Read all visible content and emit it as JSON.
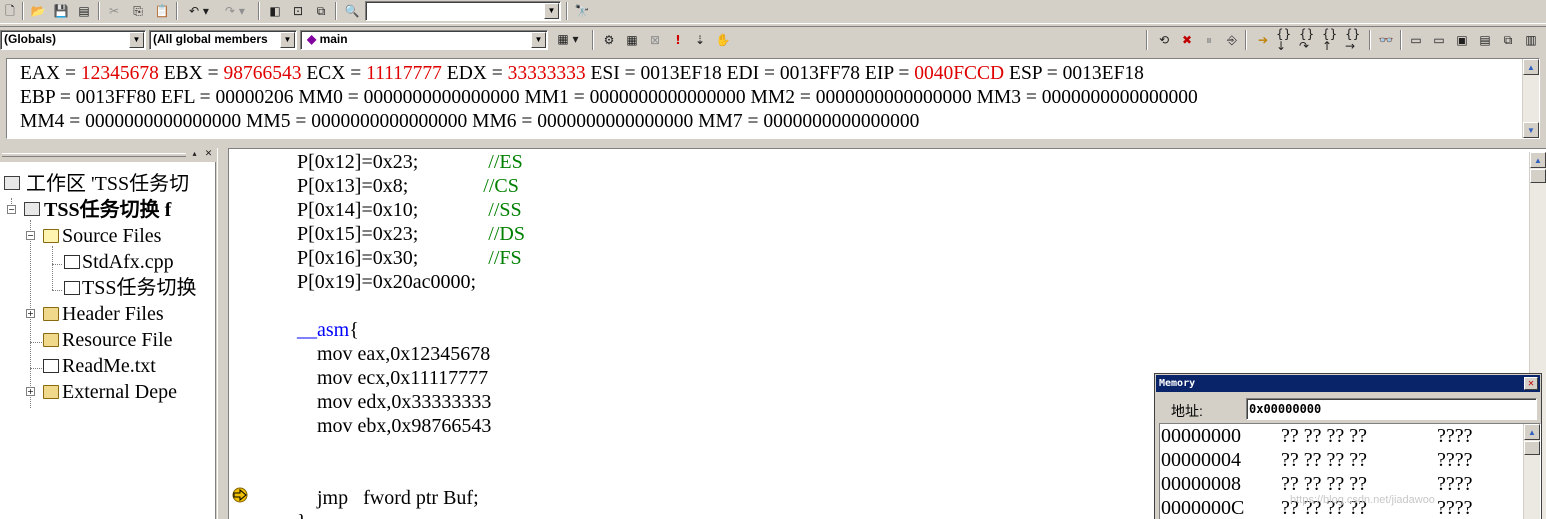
{
  "toolbar2": {
    "scope": "(Globals)",
    "members": "(All global members",
    "function": "main"
  },
  "registers": {
    "lines": [
      [
        {
          "text": "EAX = ",
          "changed": false
        },
        {
          "text": "12345678",
          "changed": true
        },
        {
          "text": " EBX = ",
          "changed": false
        },
        {
          "text": "98766543",
          "changed": true
        },
        {
          "text": " ECX = ",
          "changed": false
        },
        {
          "text": "11117777",
          "changed": true
        },
        {
          "text": " EDX = ",
          "changed": false
        },
        {
          "text": "33333333",
          "changed": true
        },
        {
          "text": " ESI = 0013EF18 EDI = 0013FF78 EIP = ",
          "changed": false
        },
        {
          "text": "0040FCCD",
          "changed": true
        },
        {
          "text": " ESP = 0013EF18",
          "changed": false
        }
      ],
      [
        {
          "text": "EBP = 0013FF80 EFL = 00000206 MM0 = 0000000000000000 MM1 = 0000000000000000 MM2 = 0000000000000000 MM3 = 0000000000000000",
          "changed": false
        }
      ],
      [
        {
          "text": "MM4 = 0000000000000000 MM5 = 0000000000000000 MM6 = 0000000000000000 MM7 = 0000000000000000",
          "changed": false
        }
      ]
    ],
    "changed_color": "#e00000"
  },
  "workspace": {
    "items": [
      {
        "label": "工作区 'TSS任务切",
        "icon": "workspace-icon",
        "bold": false
      },
      {
        "label": "TSS任务切换 f",
        "icon": "project-icon",
        "bold": true
      },
      {
        "label": "Source Files",
        "icon": "folder-open-icon",
        "bold": false
      },
      {
        "label": "StdAfx.cpp",
        "icon": "cpp-file-icon",
        "bold": false
      },
      {
        "label": "TSS任务切换",
        "icon": "cpp-file-icon",
        "bold": false
      },
      {
        "label": "Header Files",
        "icon": "folder-icon",
        "bold": false
      },
      {
        "label": "Resource File",
        "icon": "folder-icon",
        "bold": false
      },
      {
        "label": "ReadMe.txt",
        "icon": "text-file-icon",
        "bold": false
      },
      {
        "label": "External Depe",
        "icon": "folder-icon",
        "bold": false
      }
    ]
  },
  "code": {
    "lines": [
      [
        {
          "t": "P[0x12]=0x23;              ",
          "c": "plain"
        },
        {
          "t": "//ES",
          "c": "comment"
        }
      ],
      [
        {
          "t": "P[0x13]=0x8;               ",
          "c": "plain"
        },
        {
          "t": "//CS",
          "c": "comment"
        }
      ],
      [
        {
          "t": "P[0x14]=0x10;              ",
          "c": "plain"
        },
        {
          "t": "//SS",
          "c": "comment"
        }
      ],
      [
        {
          "t": "P[0x15]=0x23;              ",
          "c": "plain"
        },
        {
          "t": "//DS",
          "c": "comment"
        }
      ],
      [
        {
          "t": "P[0x16]=0x30;              ",
          "c": "plain"
        },
        {
          "t": "//FS",
          "c": "comment"
        }
      ],
      [
        {
          "t": "P[0x19]=0x20ac0000;",
          "c": "plain"
        }
      ],
      [
        {
          "t": "",
          "c": "plain"
        }
      ],
      [
        {
          "t": "__asm",
          "c": "keyword"
        },
        {
          "t": "{",
          "c": "plain"
        }
      ],
      [
        {
          "t": "    mov eax,0x12345678",
          "c": "plain"
        }
      ],
      [
        {
          "t": "    mov ecx,0x11117777",
          "c": "plain"
        }
      ],
      [
        {
          "t": "    mov edx,0x33333333",
          "c": "plain"
        }
      ],
      [
        {
          "t": "    mov ebx,0x98766543",
          "c": "plain"
        }
      ],
      [
        {
          "t": "",
          "c": "plain"
        }
      ],
      [
        {
          "t": "",
          "c": "plain"
        }
      ],
      [
        {
          "t": "    jmp   fword ptr Buf;",
          "c": "plain"
        }
      ],
      [
        {
          "t": "}",
          "c": "plain"
        }
      ]
    ]
  },
  "memory": {
    "title": "Memory",
    "address_label": "地址:",
    "address_value": "0x00000000",
    "rows": [
      {
        "addr": "00000000",
        "bytes": "?? ?? ?? ??",
        "ascii": "????"
      },
      {
        "addr": "00000004",
        "bytes": "?? ?? ?? ??",
        "ascii": "????"
      },
      {
        "addr": "00000008",
        "bytes": "?? ?? ?? ??",
        "ascii": "????"
      },
      {
        "addr": "0000000C",
        "bytes": "?? ?? ?? ??",
        "ascii": "????"
      }
    ]
  },
  "watermark": "https://blog.csdn.net/jiadawoo"
}
